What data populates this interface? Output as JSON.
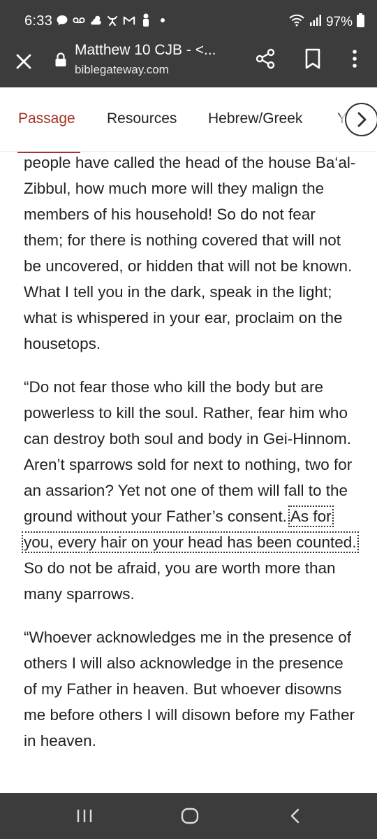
{
  "status": {
    "time": "6:33",
    "battery": "97%",
    "icons": [
      "chat-icon",
      "voicemail-icon",
      "weather-icon",
      "accessibility-icon",
      "gmail-icon",
      "person-icon",
      "dot-icon"
    ]
  },
  "toolbar": {
    "title": "Matthew 10 CJB - <...",
    "url": "biblegateway.com"
  },
  "tabs": [
    {
      "label": "Passage",
      "active": true
    },
    {
      "label": "Resources",
      "active": false
    },
    {
      "label": "Hebrew/Greek",
      "active": false
    },
    {
      "label": "Y",
      "active": false
    }
  ],
  "passage": {
    "p1": "people have called the head of the house Ba‘al-Zibbul, how much more will they malign the members of his household! So do not fear them; for there is nothing covered that will not be uncovered, or hidden that will not be known. What I tell you in the dark, speak in the light; what is whispered in your ear, proclaim on the housetops.",
    "p2_before": "“Do not fear those who kill the body but are powerless to kill the soul. Rather, fear him who can destroy both soul and body in Gei-Hinnom. Aren’t sparrows sold for next to nothing, two for an assarion? Yet not one of them will fall to the ground without your Father’s consent. ",
    "p2_highlight": "As for you, every hair on your head has been counted.",
    "p2_after": " So do not be afraid, you are worth more than many sparrows.",
    "p3": "“Whoever acknowledges me in the presence of others I will also acknowledge in the presence of my Father in heaven. But whoever disowns me before others I will disown before my Father in heaven."
  },
  "colors": {
    "bar": "#3c3c3c",
    "accent": "#a33424"
  }
}
